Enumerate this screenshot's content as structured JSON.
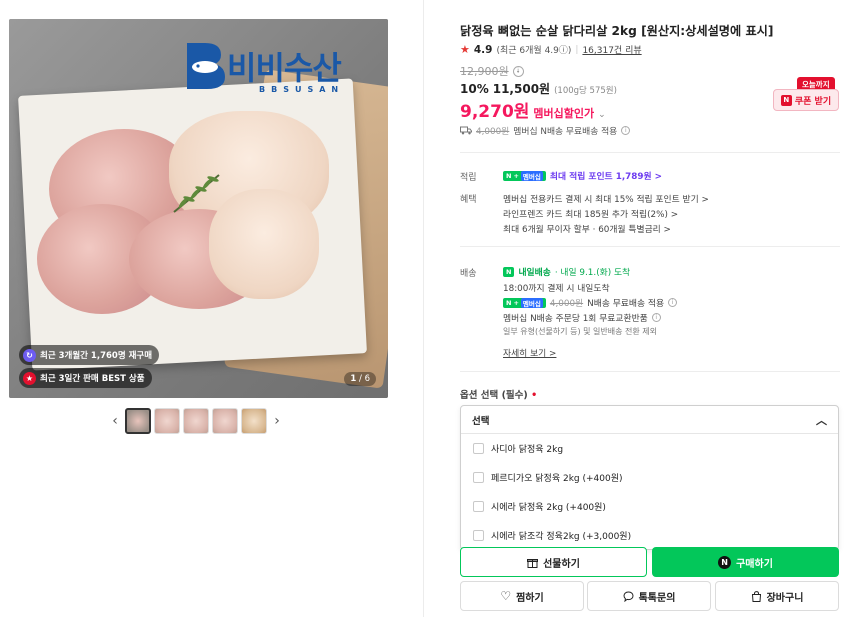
{
  "gallery": {
    "logo_text": "비비수산",
    "logo_sub": "BBSUSAN",
    "badge_repurchase": "최근 3개월간 1,760명 재구매",
    "badge_best": "최근 3일간 판매 BEST 상품",
    "counter_current": "1",
    "counter_total": "/ 6",
    "prev_arrow": "‹",
    "next_arrow": "›"
  },
  "product": {
    "title": "닭정육 뼈없는 순살 닭다리살 2kg [원산지:상세설명에 표시]",
    "rating_score": "4.9",
    "rating_detail": "(최근 6개월 4.9ⓘ)",
    "review_count": "16,317건 리뷰",
    "original_price": "12,900원",
    "discount_pct": "10%",
    "sale_price": "11,500원",
    "unit_price": "(100g당 575원)",
    "member_price": "9,270원",
    "member_label": "멤버십할인가",
    "shipping_strike": "4,000원",
    "shipping_text": "멤버십 N배송 무료배송 적용",
    "coupon_tag": "오늘까지",
    "coupon_btn": "쿠폰 받기"
  },
  "points": {
    "label": "적립",
    "badge_member": "멤버십",
    "text": "최대 적립 포인트 1,789원 >"
  },
  "benefits": {
    "label": "혜택",
    "line1": "멤버십 전용카드 결제 시 최대 15% 적립 포인트 받기 >",
    "line2": "라인프렌즈 카드 최대 185원 추가 적립(2%) >",
    "line3": "최대 6개월 무이자 할부 · 60개월 특별금리 >"
  },
  "delivery": {
    "label": "배송",
    "brand": "내일배송",
    "eta": "· 내일 9.1.(화) 도착",
    "cutoff": "18:00까지 결제 시 내일도착",
    "badge_member": "멤버십",
    "fee_strike": "4,000원",
    "fee_text": "N배송 무료배송 적용",
    "exchange": "멤버십 N배송 주문당 1회 무료교환반품",
    "exception": "일부 유형(선물하기 등) 및 일반배송 전환 제외",
    "more": "자세히 보기 >"
  },
  "options": {
    "label": "옵션 선택 (필수)",
    "required_mark": "•",
    "selected": "선택",
    "items": [
      "사디아 닭정육 2kg",
      "페르디가오 닭정육 2kg (+400원)",
      "시에라 닭정육 2kg (+400원)",
      "시에라 닭조각 정육2kg (+3,000원)"
    ]
  },
  "actions": {
    "gift": "선물하기",
    "buy": "구매하기",
    "wish": "찜하기",
    "talk": "톡톡문의",
    "cart": "장바구니"
  },
  "colors": {
    "accent_green": "#03c75a",
    "member_pink": "#f5185e",
    "coupon_red": "#e3102e",
    "points_purple": "#6d3cf0"
  }
}
